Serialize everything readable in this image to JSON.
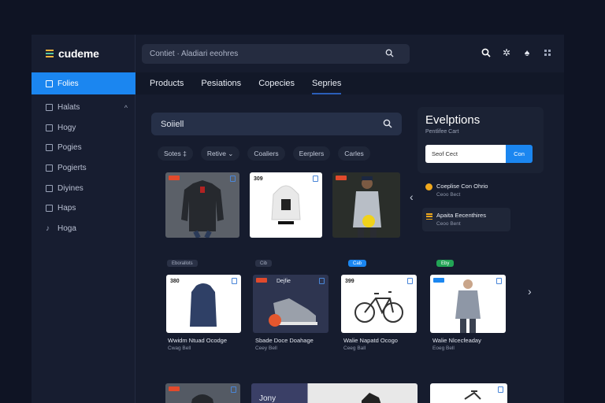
{
  "app": {
    "logo": "cudeme"
  },
  "sidebar": {
    "active_item": "Folies",
    "items": [
      {
        "label": "Halats",
        "icon": "chart-icon",
        "expandable": true
      },
      {
        "label": "Hogy",
        "icon": "bar-icon"
      },
      {
        "label": "Pogies",
        "icon": "page-icon"
      },
      {
        "label": "Pogierts",
        "icon": "doc-icon"
      },
      {
        "label": "Diyines",
        "icon": "grid-icon"
      },
      {
        "label": "Haps",
        "icon": "flag-icon"
      },
      {
        "label": "Hoga",
        "icon": "music-icon"
      }
    ]
  },
  "header": {
    "search_text": "Contiet · Aladiari eeohres",
    "icons": [
      "search-icon",
      "settings-icon",
      "flame-icon",
      "grid-icon"
    ]
  },
  "tabs": [
    "Products",
    "Pesiations",
    "Copecies",
    "Sepries"
  ],
  "active_tab": "Sepries",
  "search": {
    "label": "Soiiell"
  },
  "filters": [
    "Sotes ‡",
    "Retive ⌄",
    "Coaliers",
    "Eerplers",
    "Carles"
  ],
  "row1": [
    {
      "type": "jacket",
      "price": ""
    },
    {
      "type": "hoodie",
      "price": "309"
    },
    {
      "type": "person",
      "price": ""
    }
  ],
  "row2": [
    {
      "badge": "Eborallots",
      "badge_color": "#2a3146",
      "price": "380",
      "title": "Wwidm Ntuad Ocodge",
      "sub": "Cwag Bell",
      "type": "jacket"
    },
    {
      "badge": "Cib",
      "badge_color": "#2a3146",
      "price": "Dejfie",
      "title": "Sbade Doce Doahage",
      "sub": "Ceey Bell",
      "type": "shoe"
    },
    {
      "badge": "Cab",
      "badge_color": "#1b86f0",
      "price": "399",
      "title": "Walie Napatd Ocogo",
      "sub": "Ceeg Ball",
      "type": "bike"
    },
    {
      "badge": "Eby",
      "badge_color": "#22a455",
      "price": "",
      "title": "Walie Nlcecfeaday",
      "sub": "Eoeg Bell",
      "type": "person"
    }
  ],
  "row3": [
    {
      "type": "jacket"
    },
    {
      "type": "banner",
      "label": "Jony"
    },
    {
      "type": "bike"
    }
  ],
  "panel": {
    "title": "Evelptions",
    "subtitle": "Pentlifee Cart",
    "input_value": "Seof Cect",
    "button": "Con"
  },
  "notifications": [
    {
      "title": "Coeplise Con Ohrio",
      "sub": "Ceoo Bect",
      "icon": "dot"
    },
    {
      "title": "Apaita Eecenthires",
      "sub": "Ceoo Bent",
      "icon": "bars"
    }
  ]
}
